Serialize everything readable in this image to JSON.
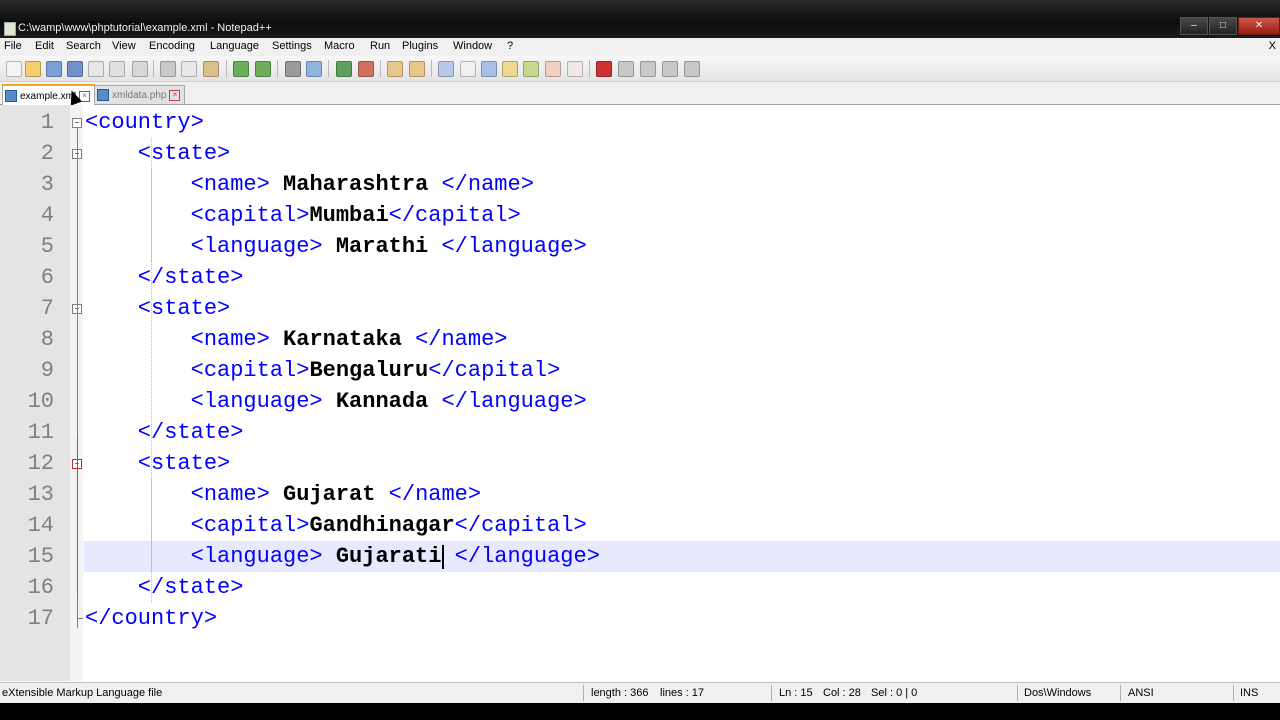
{
  "window": {
    "title": "C:\\wamp\\www\\phptutorial\\example.xml - Notepad++",
    "buttons": [
      "‒",
      "□",
      "✕"
    ]
  },
  "menu": [
    "File",
    "Edit",
    "Search",
    "View",
    "Encoding",
    "Language",
    "Settings",
    "Macro",
    "Run",
    "Plugins",
    "Window",
    "?"
  ],
  "menu_close": "X",
  "tabs": [
    {
      "label": "example.xml",
      "active": true
    },
    {
      "label": "xmldata.php",
      "active": false
    }
  ],
  "editor": {
    "lines": [
      {
        "n": "1",
        "parts": [
          [
            "tag",
            "<country>"
          ]
        ]
      },
      {
        "n": "2",
        "parts": [
          [
            "tag",
            "    <state>"
          ]
        ]
      },
      {
        "n": "3",
        "parts": [
          [
            "tag",
            "        <name> "
          ],
          [
            "val",
            "Maharashtra"
          ],
          [
            "tag",
            " </name>"
          ]
        ]
      },
      {
        "n": "4",
        "parts": [
          [
            "tag",
            "        <capital>"
          ],
          [
            "val",
            "Mumbai"
          ],
          [
            "tag",
            "</capital>"
          ]
        ]
      },
      {
        "n": "5",
        "parts": [
          [
            "tag",
            "        <language> "
          ],
          [
            "val",
            "Marathi"
          ],
          [
            "tag",
            " </language>"
          ]
        ]
      },
      {
        "n": "6",
        "parts": [
          [
            "tag",
            "    </state>"
          ]
        ]
      },
      {
        "n": "7",
        "parts": [
          [
            "tag",
            "    <state>"
          ]
        ]
      },
      {
        "n": "8",
        "parts": [
          [
            "tag",
            "        <name> "
          ],
          [
            "val",
            "Karnataka"
          ],
          [
            "tag",
            " </name>"
          ]
        ]
      },
      {
        "n": "9",
        "parts": [
          [
            "tag",
            "        <capital>"
          ],
          [
            "val",
            "Bengaluru"
          ],
          [
            "tag",
            "</capital>"
          ]
        ]
      },
      {
        "n": "10",
        "parts": [
          [
            "tag",
            "        <language> "
          ],
          [
            "val",
            "Kannada"
          ],
          [
            "tag",
            " </language>"
          ]
        ]
      },
      {
        "n": "11",
        "parts": [
          [
            "tag",
            "    </state>"
          ]
        ]
      },
      {
        "n": "12",
        "parts": [
          [
            "tag",
            "    <state>"
          ]
        ]
      },
      {
        "n": "13",
        "parts": [
          [
            "tag",
            "        <name> "
          ],
          [
            "val",
            "Gujarat"
          ],
          [
            "tag",
            " </name>"
          ]
        ]
      },
      {
        "n": "14",
        "parts": [
          [
            "tag",
            "        <capital>"
          ],
          [
            "val",
            "Gandhinagar"
          ],
          [
            "tag",
            "</capital>"
          ]
        ]
      },
      {
        "n": "15",
        "parts": [
          [
            "tag",
            "        <language> "
          ],
          [
            "val",
            "Gujarati"
          ],
          [
            "tag",
            " </language>"
          ]
        ]
      },
      {
        "n": "16",
        "parts": [
          [
            "tag",
            "    </state>"
          ]
        ]
      },
      {
        "n": "17",
        "parts": [
          [
            "tag",
            "</country>"
          ]
        ]
      }
    ],
    "current_line": 15,
    "fold_points": [
      1,
      2,
      7,
      12
    ]
  },
  "status": {
    "file_type": "eXtensible Markup Language file",
    "length": "length : 366",
    "lines": "lines : 17",
    "ln": "Ln : 15",
    "col": "Col : 28",
    "sel": "Sel : 0 | 0",
    "eol": "Dos\\Windows",
    "encoding": "ANSI",
    "mode": "INS"
  },
  "colors": {
    "tag": "#0000ff",
    "value": "#000000",
    "current_line_bg": "#e8e8ff",
    "line_number": "#808080"
  }
}
